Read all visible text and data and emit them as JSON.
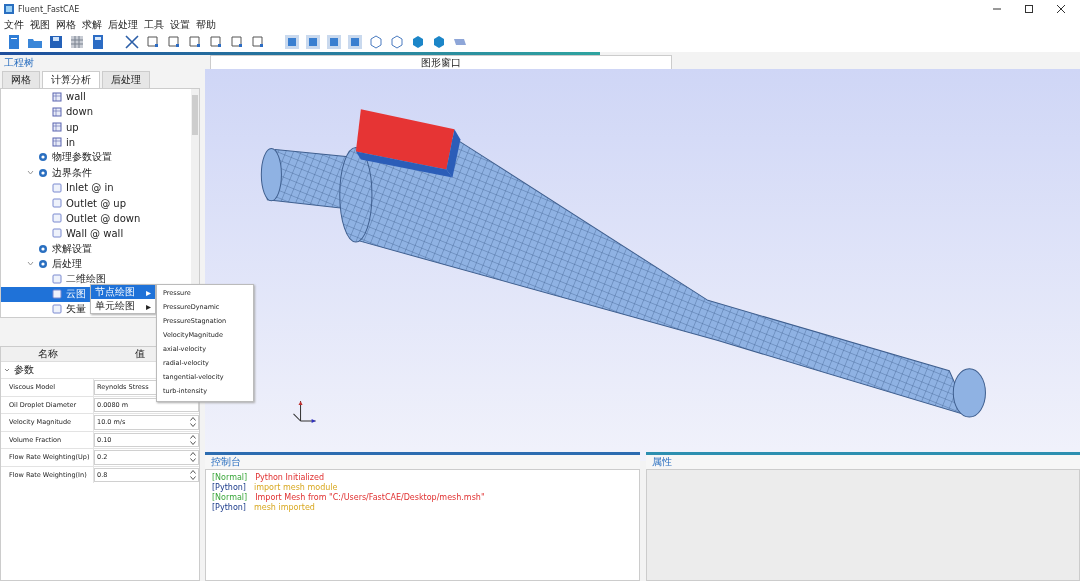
{
  "window": {
    "title": "Fluent_FastCAE"
  },
  "menu_bar": [
    "文件",
    "视图",
    "网格",
    "求解",
    "后处理",
    "工具",
    "设置",
    "帮助"
  ],
  "project_panel": {
    "title": "工程树",
    "tabs": [
      {
        "label": "网格",
        "selected": false
      },
      {
        "label": "计算分析",
        "selected": true
      },
      {
        "label": "后处理",
        "selected": false
      }
    ]
  },
  "tree": {
    "items": [
      {
        "label": "wall",
        "kind": "part",
        "selected": false
      },
      {
        "label": "down",
        "kind": "part",
        "selected": false
      },
      {
        "label": "up",
        "kind": "part",
        "selected": false
      },
      {
        "label": "in",
        "kind": "part",
        "selected": false
      },
      {
        "label": "物理参数设置",
        "kind": "node",
        "selected": false
      },
      {
        "label": "边界条件",
        "kind": "node",
        "selected": false,
        "expanded": true,
        "children": [
          {
            "label": "Inlet @ in",
            "kind": "bc",
            "selected": false
          },
          {
            "label": "Outlet @ up",
            "kind": "bc",
            "selected": false
          },
          {
            "label": "Outlet @ down",
            "kind": "bc",
            "selected": false
          },
          {
            "label": "Wall @ wall",
            "kind": "bc",
            "selected": false
          }
        ]
      },
      {
        "label": "求解设置",
        "kind": "node",
        "selected": false
      },
      {
        "label": "后处理",
        "kind": "node",
        "selected": false,
        "expanded": true,
        "children": [
          {
            "label": "二维绘图",
            "kind": "bc",
            "selected": false
          },
          {
            "label": "云图",
            "kind": "bc",
            "selected": true
          },
          {
            "label": "矢量",
            "kind": "bc",
            "selected": false
          }
        ]
      }
    ]
  },
  "context_menu": {
    "items": [
      {
        "label": "节点绘图",
        "arrow": "▸",
        "selected": true
      },
      {
        "label": "单元绘图",
        "arrow": "▸",
        "selected": false
      }
    ]
  },
  "submenu": {
    "items": [
      "Pressure",
      "PressureDynamic",
      "PressureStagnation",
      "VelocityMagnitude",
      "axial-velocity",
      "radial-velocity",
      "tangential-velocity",
      "turb-intensity"
    ]
  },
  "properties": {
    "columns": [
      "名称",
      "值"
    ],
    "group": "参数",
    "rows": [
      {
        "name": "Viscous Model",
        "value": "Reynolds Stress",
        "kind": "text"
      },
      {
        "name": "Oil Droplet Diameter",
        "value": "0.0080 m",
        "kind": "text"
      },
      {
        "name": "Velocity Magnitude",
        "value": "10.0 m/s",
        "kind": "spin"
      },
      {
        "name": "Volume Fraction",
        "value": "0.10",
        "kind": "spin"
      },
      {
        "name": "Flow Rate Weighting(Up)",
        "value": "0.2",
        "kind": "spin"
      },
      {
        "name": "Flow Rate Weighting(In)",
        "value": "0.8",
        "kind": "spin"
      }
    ]
  },
  "viewport": {
    "tab": "图形窗口"
  },
  "console": {
    "title": "控制台",
    "lines": [
      {
        "tag": "[Normal]",
        "kind": "normal",
        "text": "Python Initialized"
      },
      {
        "tag": "[Python]",
        "kind": "python",
        "text": "import mesh module"
      },
      {
        "tag": "[Normal]",
        "kind": "normal",
        "text": "Import Mesh from \"C:/Users/FastCAE/Desktop/mesh.msh\""
      },
      {
        "tag": "[Python]",
        "kind": "python",
        "text": "mesh imported"
      }
    ]
  },
  "property_panel": {
    "title": "属性"
  }
}
